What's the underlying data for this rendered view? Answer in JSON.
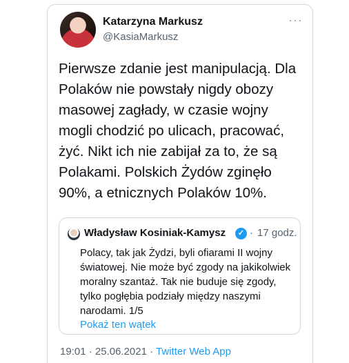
{
  "tweet": {
    "author_name": "Katarzyna Markusz",
    "author_handle": "@KasiaMarkusz",
    "more_label": "···",
    "text": "Pierwsze zdanie jest manipulacją. Dla\nPolaków nie powstały nigdy obozy\nmasowej zagłady, w czasie wojny\nmogli chodzić po ulicach, pracować,\nżyć. Nikt ich nie zabijał za to, że są\nPolakami. Polskich Żydów zginęło\n90%, a etnicznych Polaków 10%.",
    "footer": {
      "time": "19:01",
      "date": "25.06.2021",
      "separator": "·",
      "app": "Twitter Web App"
    }
  },
  "quote": {
    "author_name": "Władysław Kosiniak-Kamysz",
    "verified_icon": "verified-badge-icon",
    "separator": "·",
    "time_ago": "17 godz.",
    "text": "Polacy, tak jak Żydzi, byli ofiarami II wojny\nświatowej. Nie może być zgody na jakikolwiek\nmoralny szantaż. Tak nie buduje się zgody,\ntylko pogłębia podziały między naszymi\nnarodami. 1/5",
    "show_thread": "Pokaż ten wątek"
  },
  "colors": {
    "link": "#1d9bf0",
    "secondary_text": "#536471",
    "border": "#cfd9de"
  }
}
